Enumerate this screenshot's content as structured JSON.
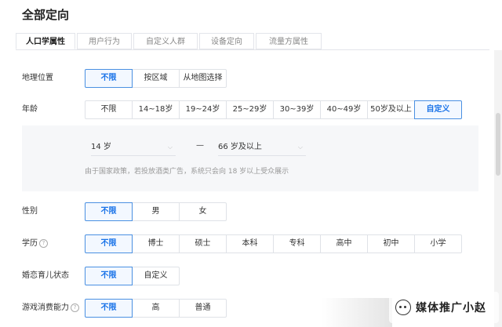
{
  "page": {
    "title": "全部定向"
  },
  "tabs": [
    "人口学属性",
    "用户行为",
    "自定义人群",
    "设备定向",
    "流量方属性"
  ],
  "geo": {
    "label": "地理位置",
    "options": [
      "不限",
      "按区域",
      "从地图选择"
    ]
  },
  "age": {
    "label": "年龄",
    "options": [
      "不限",
      "14~18岁",
      "19~24岁",
      "25~29岁",
      "30~39岁",
      "40~49岁",
      "50岁及以上",
      "自定义"
    ],
    "from_value": "14 岁",
    "separator": "—",
    "to_value": "66 岁及以上",
    "note": "由于国家政策，若投放酒类广告，系统只会向 18 岁以上受众展示"
  },
  "gender": {
    "label": "性别",
    "options": [
      "不限",
      "男",
      "女"
    ]
  },
  "education": {
    "label": "学历",
    "help_icon": "?",
    "options": [
      "不限",
      "博士",
      "硕士",
      "本科",
      "专科",
      "高中",
      "初中",
      "小学"
    ]
  },
  "marital": {
    "label": "婚恋育儿状态",
    "options": [
      "不限",
      "自定义"
    ]
  },
  "gaming": {
    "label": "游戏消费能力",
    "help_icon": "?",
    "options": [
      "不限",
      "高",
      "普通"
    ]
  },
  "watermark": {
    "text": "媒体推广小赵"
  },
  "colors": {
    "accent": "#1a73e8",
    "active_bg": "#f3f8ff",
    "border": "#dfe2e7"
  }
}
